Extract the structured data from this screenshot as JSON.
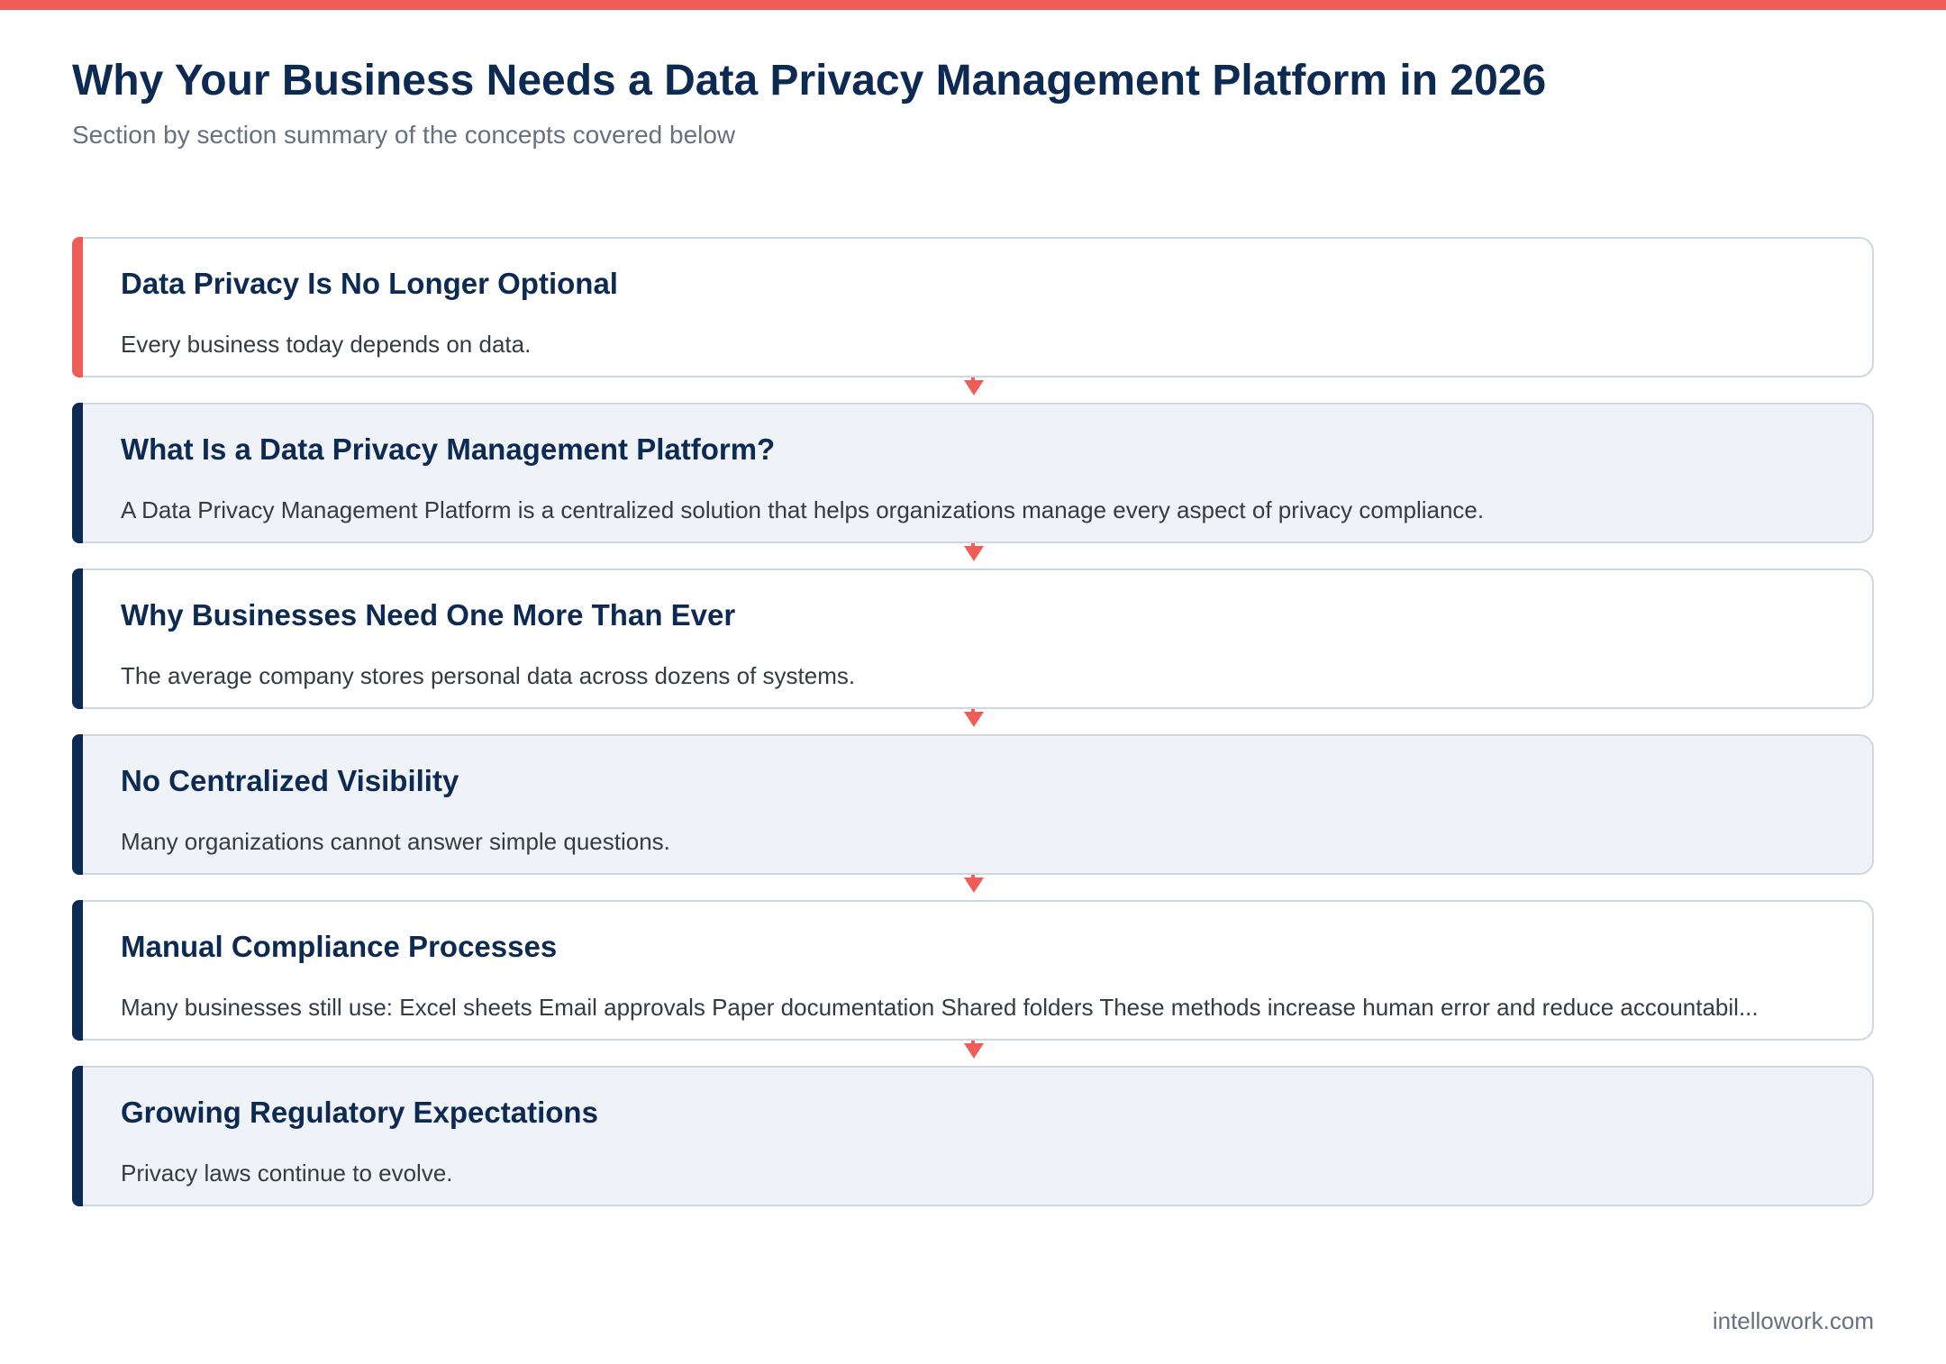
{
  "header": {
    "title": "Why Your Business Needs a Data Privacy Management Platform in 2026",
    "subtitle": "Section by section summary of the concepts covered below"
  },
  "colors": {
    "accent": "#ee5d57",
    "navy": "#0c2a52",
    "card_shaded": "#eff3f7",
    "card_border": "#cfd7e1"
  },
  "sections": [
    {
      "title": "Data Privacy Is No Longer Optional",
      "summary": "Every business today depends on data."
    },
    {
      "title": "What Is a Data Privacy Management Platform?",
      "summary": "A Data Privacy Management Platform is a centralized solution that helps organizations manage every aspect of privacy compliance."
    },
    {
      "title": "Why Businesses Need One More Than Ever",
      "summary": "The average company stores personal data across dozens of systems."
    },
    {
      "title": "No Centralized Visibility",
      "summary": "Many organizations cannot answer simple questions."
    },
    {
      "title": "Manual Compliance Processes",
      "summary": "Many businesses still use: Excel sheets Email approvals Paper documentation Shared folders These methods increase human error and reduce accountabil..."
    },
    {
      "title": "Growing Regulatory Expectations",
      "summary": "Privacy laws continue to evolve."
    }
  ],
  "footer": {
    "site": "intellowork.com"
  }
}
